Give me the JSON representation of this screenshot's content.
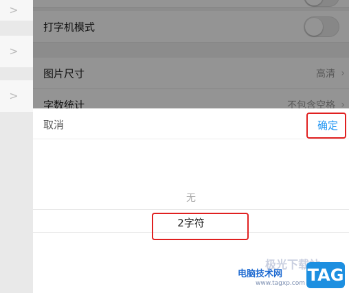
{
  "settings": {
    "rows": [
      {
        "label": "打字机模式",
        "value": "",
        "type": "toggle"
      },
      {
        "label": "图片尺寸",
        "value": "高清",
        "type": "chevron"
      },
      {
        "label": "字数统计",
        "value": "不包含空格",
        "type": "chevron"
      }
    ]
  },
  "left_rows": [
    ">",
    ">",
    ">"
  ],
  "sheet": {
    "cancel": "取消",
    "confirm": "确定",
    "options": [
      "无",
      "2字符"
    ],
    "selected": "2字符"
  },
  "watermark": {
    "site": "电脑技术网",
    "url": "www.tagxp.com",
    "logo": "TAG",
    "top_text": "极光下载站"
  },
  "colors": {
    "accent": "#2196f3",
    "highlight": "#e02020"
  }
}
